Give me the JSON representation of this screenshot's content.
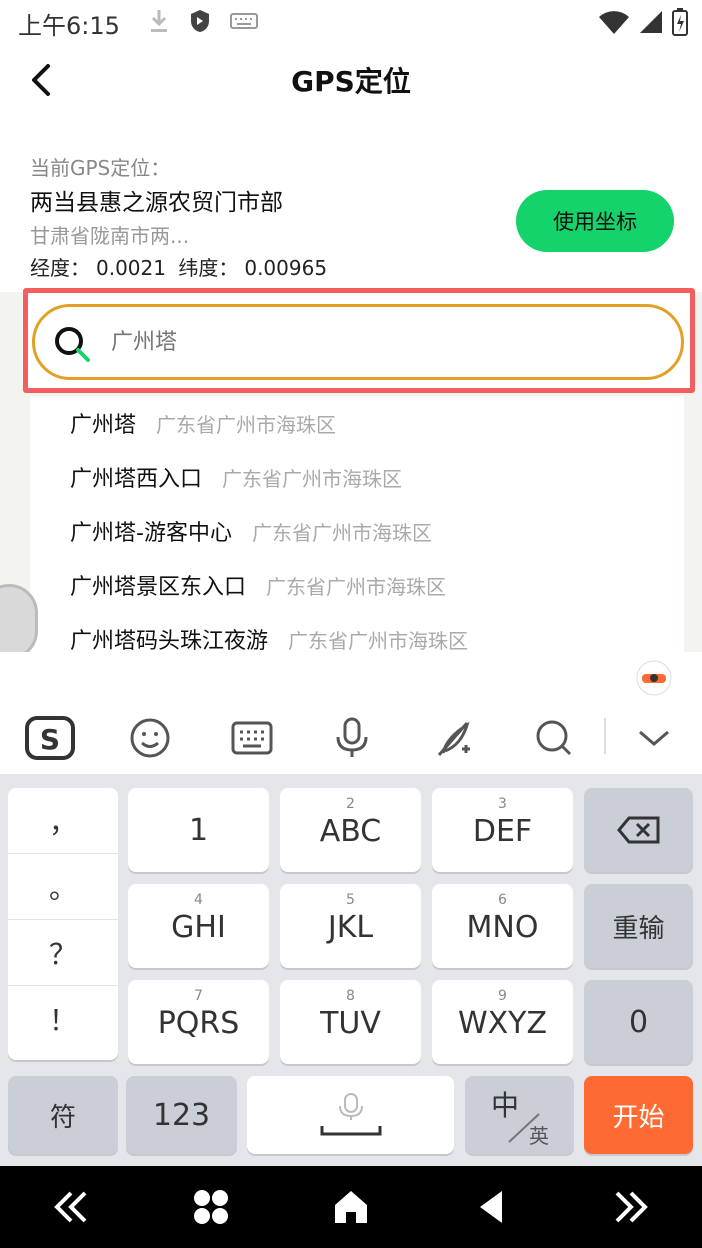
{
  "status_bar": {
    "time": "上午6:15"
  },
  "header": {
    "title": "GPS定位"
  },
  "location": {
    "label": "当前GPS定位：",
    "name": "两当县惠之源农贸门市部",
    "address": "甘肃省陇南市两...",
    "longitude_label": "经度：",
    "longitude_value": "0.0021",
    "latitude_label": "纬度：",
    "latitude_value": "0.00965",
    "use_button": "使用坐标"
  },
  "search": {
    "placeholder": "广州塔"
  },
  "results": [
    {
      "name": "广州塔",
      "address": "广东省广州市海珠区"
    },
    {
      "name": "广州塔西入口",
      "address": "广东省广州市海珠区"
    },
    {
      "name": "广州塔-游客中心",
      "address": "广东省广州市海珠区"
    },
    {
      "name": "广州塔景区东入口",
      "address": "广东省广州市海珠区"
    },
    {
      "name": "广州塔码头珠江夜游",
      "address": "广东省广州市海珠区"
    }
  ],
  "keyboard": {
    "punctuation": [
      "，",
      "。",
      "？",
      "！"
    ],
    "row1": {
      "k1": "1",
      "k2_num": "2",
      "k2": "ABC",
      "k3_num": "3",
      "k3": "DEF"
    },
    "row2": {
      "k4_num": "4",
      "k4": "GHI",
      "k5_num": "5",
      "k5": "JKL",
      "k6_num": "6",
      "k6": "MNO",
      "retype": "重输"
    },
    "row3": {
      "k7_num": "7",
      "k7": "PQRS",
      "k8_num": "8",
      "k8": "TUV",
      "k9_num": "9",
      "k9": "WXYZ",
      "zero": "0"
    },
    "bottom": {
      "symbols": "符",
      "numbers": "123",
      "lang_cn": "中",
      "lang_en": "英",
      "start": "开始"
    }
  },
  "colors": {
    "accent_green": "#14d36b",
    "search_border": "#e0a126",
    "highlight_red": "#f35e5e",
    "start_orange": "#ff6a32"
  }
}
